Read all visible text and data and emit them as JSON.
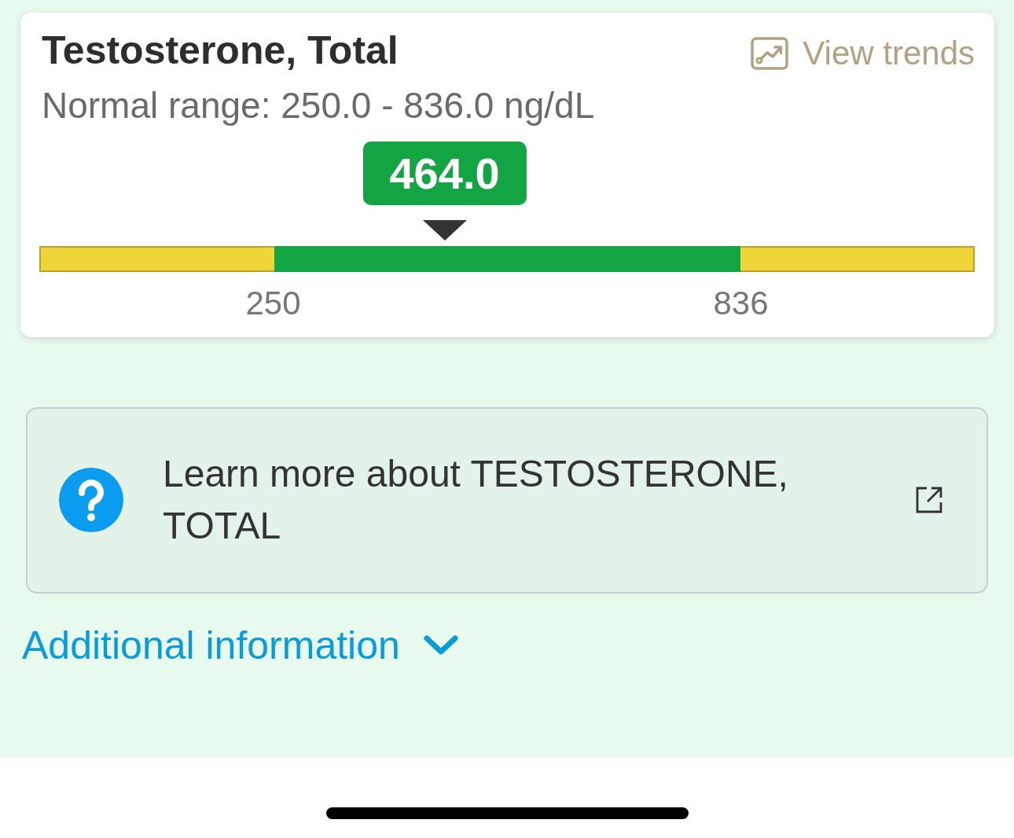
{
  "card": {
    "title": "Testosterone, Total",
    "trends_link": {
      "label": "View trends"
    },
    "normal_range": "Normal range: 250.0 - 836.0 ng/dL",
    "result": {
      "value": "464.0",
      "in_range": true,
      "level": 0.433
    },
    "range_ticks": [
      "250",
      "836"
    ]
  },
  "learn_more": {
    "text": "Learn more about TESTOSTERONE, TOTAL"
  },
  "additional_info": {
    "label": "Additional information",
    "expanded": false
  }
}
